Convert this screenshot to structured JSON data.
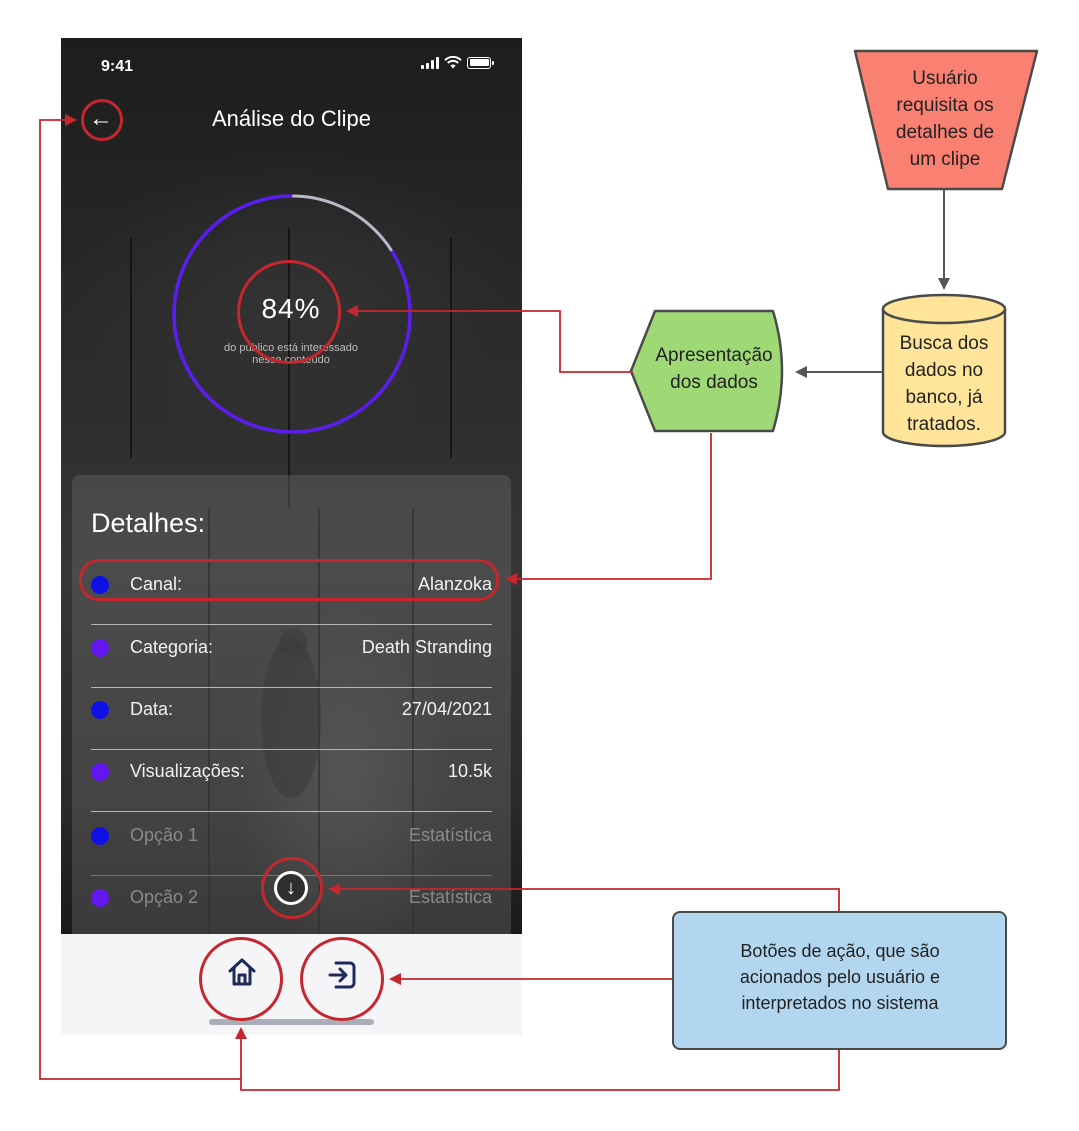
{
  "phone": {
    "status": {
      "time": "9:41"
    },
    "header": {
      "back_label": "←",
      "title": "Análise do Clipe"
    },
    "ring": {
      "percent_label": "84%",
      "percent_value": 0.84,
      "caption_line1": "do público está interessado",
      "caption_line2": "nesse conteúdo",
      "colors": {
        "filled": "#5b1cf0",
        "rest": "#b8bcc8"
      }
    },
    "details": {
      "title": "Detalhes:",
      "rows": [
        {
          "label": "Canal:",
          "value": "Alanzoka",
          "dot": "#0f10e6"
        },
        {
          "label": "Categoria:",
          "value": "Death Stranding",
          "dot": "#6217f0"
        },
        {
          "label": "Data:",
          "value": "27/04/2021",
          "dot": "#0f10e6"
        },
        {
          "label": "Visualizações:",
          "value": "10.5k",
          "dot": "#6217f0"
        },
        {
          "label": "Opção 1",
          "value": "Estatística",
          "dot": "#0f10e6"
        },
        {
          "label": "Opção 2",
          "value": "Estatística",
          "dot": "#6217f0"
        }
      ]
    },
    "scroll_icon": "arrow-down-circle-icon",
    "nav": {
      "home_icon": "home-icon",
      "exit_icon": "logout-icon"
    }
  },
  "flow": {
    "start": {
      "lines": [
        "Usuário",
        "requisita os",
        "detalhes de",
        "um clipe"
      ],
      "color": "#fa8072"
    },
    "database": {
      "lines": [
        "Busca dos",
        "dados no",
        "banco, já",
        "tratados."
      ],
      "color": "#ffe49a"
    },
    "display": {
      "lines": [
        "Apresentação",
        "dos dados"
      ],
      "color": "#9fd975"
    },
    "actions": {
      "lines": [
        "Botões de ação, que são",
        "acionados pelo usuário e",
        "interpretados no sistema"
      ],
      "color": "#b3d6f0"
    },
    "callout_color": "#c6262e",
    "connector_color": "#555555"
  }
}
